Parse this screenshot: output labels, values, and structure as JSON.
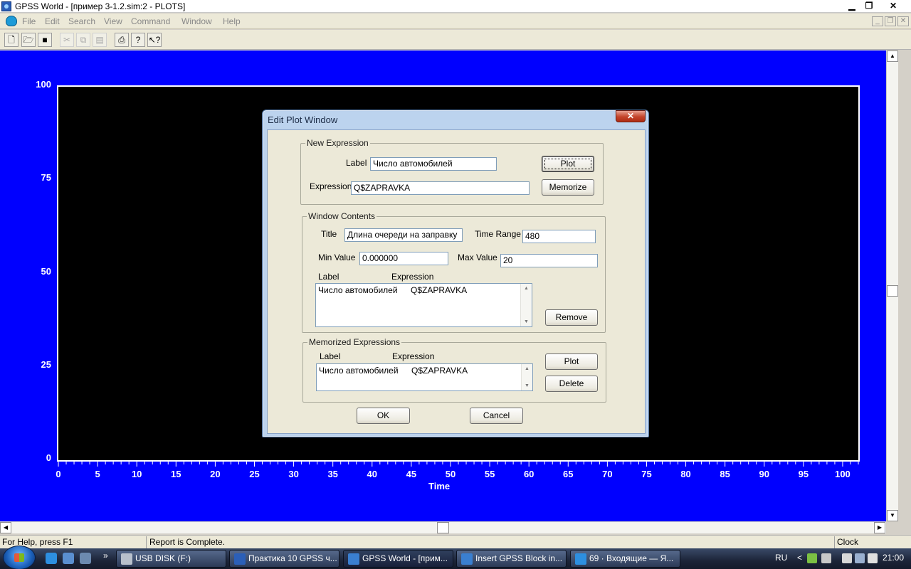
{
  "window": {
    "title": "GPSS World - [пример 3-1.2.sim:2  -  PLOTS]",
    "controls": {
      "minimize": "▁",
      "maximize": "❐",
      "close": "✕"
    }
  },
  "menu": [
    "File",
    "Edit",
    "Search",
    "View",
    "Command",
    "Window",
    "Help"
  ],
  "mdi_controls": {
    "minimize": "_",
    "restore": "❐",
    "close": "✕"
  },
  "toolbar": {
    "buttons": [
      "new-icon",
      "open-icon",
      "save-icon",
      "cut-icon",
      "copy-icon",
      "paste-icon",
      "print-icon",
      "help-icon",
      "context-help-icon"
    ]
  },
  "chart_data": {
    "type": "line",
    "title": "",
    "xlabel": "Time",
    "ylabel": "",
    "xlim": [
      0,
      102
    ],
    "ylim": [
      0,
      100
    ],
    "x_ticks": [
      "0",
      "5",
      "10",
      "15",
      "20",
      "25",
      "30",
      "35",
      "40",
      "45",
      "50",
      "55",
      "60",
      "65",
      "70",
      "75",
      "80",
      "85",
      "90",
      "95",
      "100"
    ],
    "y_ticks": [
      "100",
      "75",
      "50",
      "25",
      "0"
    ],
    "series": [],
    "background": "#000000",
    "frame_color": "#0000ff"
  },
  "dialog": {
    "title": "Edit Plot Window",
    "close_label": "✕",
    "new_expression": {
      "legend": "New Expression",
      "label_caption": "Label",
      "label_value": "Число автомобилей",
      "expression_caption": "Expression",
      "expression_value": "Q$ZAPRAVKA",
      "plot_button": "Plot",
      "memorize_button": "Memorize"
    },
    "window_contents": {
      "legend": "Window Contents",
      "title_caption": "Title",
      "title_value": "Длина очереди на заправку",
      "time_range_caption": "Time Range",
      "time_range_value": "480",
      "min_value_caption": "Min Value",
      "min_value": "0.000000",
      "max_value_caption": "Max Value",
      "max_value": "20",
      "col_label": "Label",
      "col_expression": "Expression",
      "rows": [
        {
          "label": "Число автомобилей",
          "expression": "Q$ZAPRAVKA"
        }
      ],
      "remove_button": "Remove"
    },
    "memorized": {
      "legend": "Memorized Expressions",
      "col_label": "Label",
      "col_expression": "Expression",
      "rows": [
        {
          "label": "Число автомобилей",
          "expression": "Q$ZAPRAVKA"
        }
      ],
      "plot_button": "Plot",
      "delete_button": "Delete"
    },
    "ok_button": "OK",
    "cancel_button": "Cancel"
  },
  "statusbar": {
    "help_text": "For Help, press F1",
    "report_text": "Report is Complete.",
    "clock_text": "Clock"
  },
  "taskbar": {
    "tasks": [
      {
        "label": "USB DISK (F:)"
      },
      {
        "label": "Практика 10 GPSS ч..."
      },
      {
        "label": "GPSS World - [прим...",
        "active": true
      },
      {
        "label": "Insert GPSS Block in..."
      },
      {
        "label": "69 · Входящие — Я..."
      }
    ],
    "lang": "RU",
    "time": "21:00",
    "overflow": "»",
    "tray_arrow": "<"
  }
}
